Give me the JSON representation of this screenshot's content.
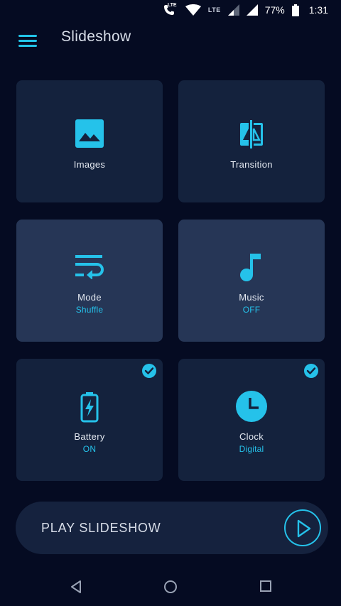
{
  "status_bar": {
    "call_lte": "LTE",
    "lte_label": "LTE",
    "battery_percent": "77%",
    "time": "1:31"
  },
  "app_bar": {
    "title": "Slideshow"
  },
  "tiles": [
    {
      "label": "Images",
      "sub": "",
      "icon": "image-icon"
    },
    {
      "label": "Transition",
      "sub": "",
      "icon": "transition-icon"
    },
    {
      "label": "Mode",
      "sub": "Shuffle",
      "icon": "wrap-text-icon"
    },
    {
      "label": "Music",
      "sub": "OFF",
      "icon": "music-note-icon"
    },
    {
      "label": "Battery",
      "sub": "ON",
      "icon": "battery-charging-icon",
      "checked": true
    },
    {
      "label": "Clock",
      "sub": "Digital",
      "icon": "clock-icon",
      "checked": true
    }
  ],
  "play": {
    "label": "PLAY SLIDESHOW"
  },
  "colors": {
    "background": "#050b22",
    "tile": "#14223d",
    "tile_highlight": "#263656",
    "accent": "#25c2ea",
    "text": "#e3e8f0"
  }
}
